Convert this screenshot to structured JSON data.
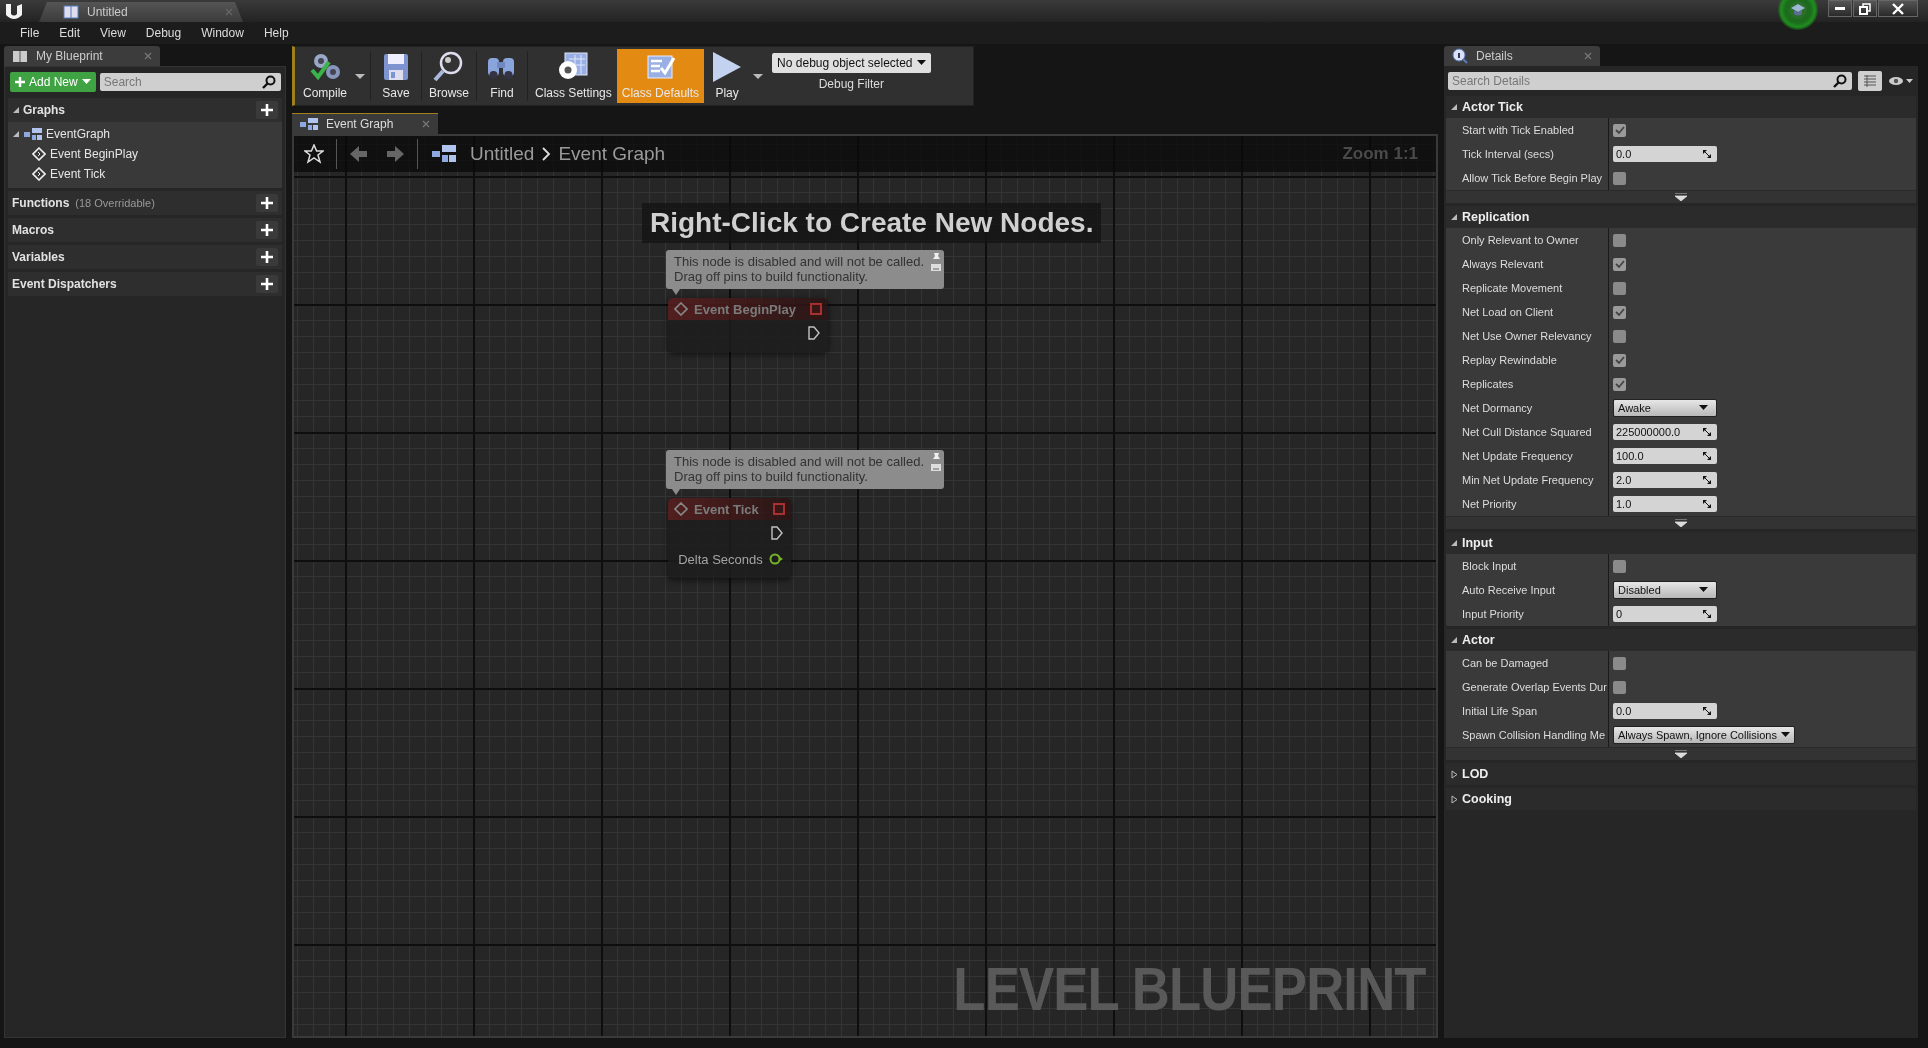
{
  "window": {
    "title": "Untitled"
  },
  "menu": [
    "File",
    "Edit",
    "View",
    "Debug",
    "Window",
    "Help"
  ],
  "my_blueprint": {
    "tab": "My Blueprint",
    "add_button": "Add New",
    "search": {
      "placeholder": "Search"
    },
    "sections": [
      {
        "title": "Graphs",
        "expanded": true,
        "children": [
          {
            "label": "EventGraph",
            "kind": "graph",
            "expanded": true,
            "children": [
              {
                "label": "Event BeginPlay",
                "kind": "event"
              },
              {
                "label": "Event Tick",
                "kind": "event"
              }
            ]
          }
        ]
      },
      {
        "title": "Functions",
        "note": "(18 Overridable)"
      },
      {
        "title": "Macros"
      },
      {
        "title": "Variables"
      },
      {
        "title": "Event Dispatchers"
      }
    ]
  },
  "toolbar": {
    "buttons": [
      {
        "label": "Compile",
        "kind": "compile",
        "selected": false,
        "dropdown": true
      },
      {
        "label": "Save",
        "kind": "save",
        "selected": false,
        "dropdown": false
      },
      {
        "label": "Browse",
        "kind": "browse",
        "selected": false,
        "dropdown": false
      },
      {
        "label": "Find",
        "kind": "find",
        "selected": false,
        "dropdown": false
      },
      {
        "label": "Class Settings",
        "kind": "settings",
        "selected": false,
        "dropdown": false
      },
      {
        "label": "Class Defaults",
        "kind": "defaults",
        "selected": true,
        "dropdown": false
      },
      {
        "label": "Play",
        "kind": "play",
        "selected": false,
        "dropdown": true
      }
    ],
    "debug_filter": {
      "value": "No debug object selected",
      "label": "Debug Filter"
    }
  },
  "graph": {
    "tab": "Event Graph",
    "breadcrumb": [
      "Untitled",
      "Event Graph"
    ],
    "zoom": "Zoom 1:1",
    "hint": "Right-Click to Create New Nodes.",
    "watermark": "LEVEL BLUEPRINT",
    "nodes": [
      {
        "title": "Event BeginPlay",
        "disabled": true,
        "comment": [
          "This node is disabled and will not be called.",
          "Drag off pins to build functionality."
        ]
      },
      {
        "title": "Event Tick",
        "disabled": true,
        "comment": [
          "This node is disabled and will not be called.",
          "Drag off pins to build functionality."
        ],
        "outputs": [
          {
            "label": "Delta Seconds"
          }
        ]
      }
    ]
  },
  "details": {
    "tab": "Details",
    "search": {
      "placeholder": "Search Details"
    },
    "categories": [
      {
        "title": "Actor Tick",
        "expanded": true,
        "advanced": true,
        "rows": [
          {
            "label": "Start with Tick Enabled",
            "kind": "checkbox",
            "checked": true
          },
          {
            "label": "Tick Interval (secs)",
            "kind": "number",
            "value": "0.0"
          },
          {
            "label": "Allow Tick Before Begin Play",
            "kind": "checkbox",
            "checked": false
          }
        ]
      },
      {
        "title": "Replication",
        "expanded": true,
        "advanced": true,
        "rows": [
          {
            "label": "Only Relevant to Owner",
            "kind": "checkbox",
            "checked": false
          },
          {
            "label": "Always Relevant",
            "kind": "checkbox",
            "checked": true
          },
          {
            "label": "Replicate Movement",
            "kind": "checkbox",
            "checked": false
          },
          {
            "label": "Net Load on Client",
            "kind": "checkbox",
            "checked": true
          },
          {
            "label": "Net Use Owner Relevancy",
            "kind": "checkbox",
            "checked": false
          },
          {
            "label": "Replay Rewindable",
            "kind": "checkbox",
            "checked": true
          },
          {
            "label": "Replicates",
            "kind": "checkbox",
            "checked": true
          },
          {
            "label": "Net Dormancy",
            "kind": "dropdown",
            "value": "Awake"
          },
          {
            "label": "Net Cull Distance Squared",
            "kind": "number",
            "value": "225000000.0"
          },
          {
            "label": "Net Update Frequency",
            "kind": "number",
            "value": "100.0"
          },
          {
            "label": "Min Net Update Frequency",
            "kind": "number",
            "value": "2.0"
          },
          {
            "label": "Net Priority",
            "kind": "number",
            "value": "1.0"
          }
        ]
      },
      {
        "title": "Input",
        "expanded": true,
        "advanced": false,
        "rows": [
          {
            "label": "Block Input",
            "kind": "checkbox",
            "checked": false
          },
          {
            "label": "Auto Receive Input",
            "kind": "dropdown",
            "value": "Disabled"
          },
          {
            "label": "Input Priority",
            "kind": "number",
            "value": "0"
          }
        ]
      },
      {
        "title": "Actor",
        "expanded": true,
        "advanced": true,
        "rows": [
          {
            "label": "Can be Damaged",
            "kind": "checkbox",
            "checked": false
          },
          {
            "label": "Generate Overlap Events Dur",
            "kind": "checkbox",
            "checked": false
          },
          {
            "label": "Initial Life Span",
            "kind": "number",
            "value": "0.0"
          },
          {
            "label": "Spawn Collision Handling Me",
            "kind": "dropdown",
            "value": "Always Spawn, Ignore Collisions",
            "wide": true
          }
        ]
      },
      {
        "title": "LOD",
        "expanded": false
      },
      {
        "title": "Cooking",
        "expanded": false
      }
    ]
  }
}
